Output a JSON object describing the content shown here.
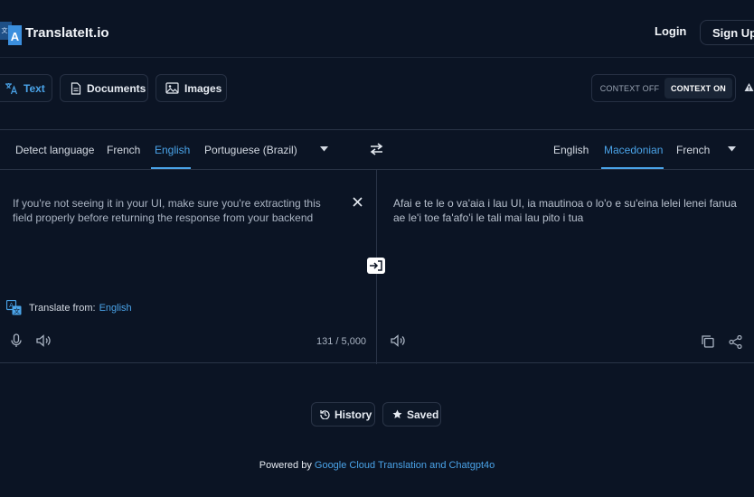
{
  "header": {
    "brand": "TranslateIt.io",
    "login_label": "Login",
    "signup_label": "Sign Up"
  },
  "modes": {
    "text": "Text",
    "documents": "Documents",
    "images": "Images"
  },
  "context": {
    "off_label": "CONTEXT OFF",
    "on_label": "CONTEXT ON",
    "selected": "on"
  },
  "source_languages": {
    "items": [
      "Detect language",
      "French",
      "English",
      "Portuguese (Brazil)"
    ],
    "active": "English"
  },
  "target_languages": {
    "items": [
      "English",
      "Macedonian",
      "French"
    ],
    "active": "Macedonian"
  },
  "source": {
    "text": "If you're not seeing it in your UI, make sure you're extracting this field properly before returning the response from your backend",
    "translate_from_label": "Translate from:",
    "translate_from_value": "English",
    "char_count": "131 / 5,000"
  },
  "target": {
    "text": "Afai e te le o va'aia i lau UI, ia mautinoa o lo'o e su'eina lelei lenei fanua ae le'i toe fa'afo'i le tali mai lau pito i tua"
  },
  "footer": {
    "history_label": "History",
    "saved_label": "Saved",
    "powered_prefix": "Powered by",
    "powered_link": "Google Cloud Translation and Chatgpt4o"
  },
  "colors": {
    "background": "#0b1424",
    "accent": "#4aa3e8",
    "border": "#2a3447"
  }
}
